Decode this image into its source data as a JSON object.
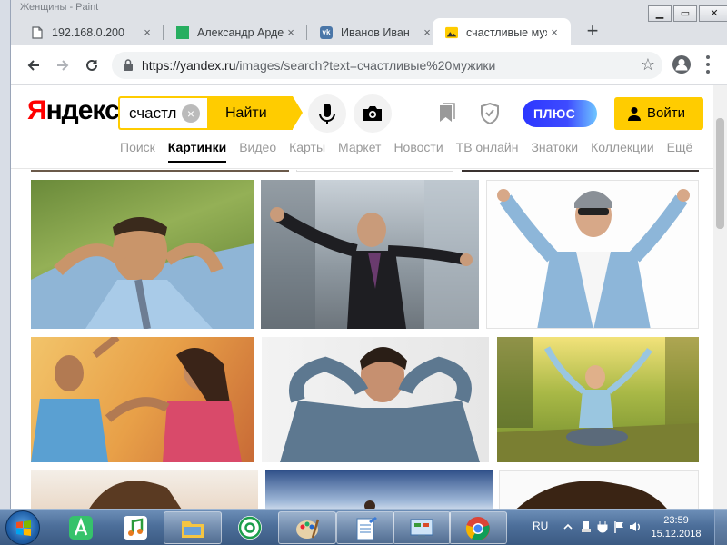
{
  "browser": {
    "background_window_title": "Женщины - Paint",
    "tabs": [
      {
        "title": "192.168.0.200",
        "icon": "page-icon",
        "active": false
      },
      {
        "title": "Александр Арде",
        "icon": "green-square-icon",
        "active": false
      },
      {
        "title": "Иванов Иван",
        "icon": "vk-icon",
        "active": false
      },
      {
        "title": "счастливые муж",
        "icon": "yandex-images-icon",
        "active": true
      }
    ],
    "tab_close": "×",
    "new_tab": "+",
    "url_host": "https://yandex.ru",
    "url_rest": "/images/search?text=счастливые%20мужики",
    "window_buttons": {
      "minimize": "▁",
      "maximize": "▭",
      "close": "✕"
    }
  },
  "yandex": {
    "logo_first": "Я",
    "logo_rest": "ндекс",
    "search_value": "счастл",
    "search_clear": "×",
    "find_button": "Найти",
    "plus_label": "ПЛЮС",
    "login_button": "Войти",
    "services": [
      {
        "label": "Поиск",
        "active": false
      },
      {
        "label": "Картинки",
        "active": true
      },
      {
        "label": "Видео",
        "active": false
      },
      {
        "label": "Карты",
        "active": false
      },
      {
        "label": "Маркет",
        "active": false
      },
      {
        "label": "Новости",
        "active": false
      },
      {
        "label": "ТВ онлайн",
        "active": false
      },
      {
        "label": "Знатоки",
        "active": false
      },
      {
        "label": "Коллекции",
        "active": false
      },
      {
        "label": "Ещё",
        "active": false
      }
    ],
    "accent_color": "#ffcc00"
  },
  "taskbar": {
    "language": "RU",
    "time": "23:59",
    "date": "15.12.2018",
    "apps": [
      "start-orb",
      "aimp-icon",
      "music-icon",
      "file-explorer-icon",
      "mail-agent-icon",
      "paint-icon",
      "notepad-icon",
      "control-panel-icon",
      "chrome-icon"
    ]
  }
}
